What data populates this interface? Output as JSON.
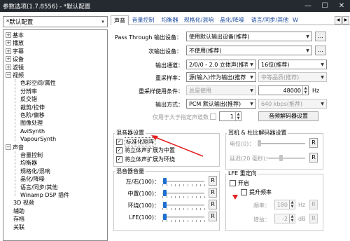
{
  "window": {
    "title": "参数选项(1.7.8556) - *默认配置",
    "minimize": "—",
    "maximize": "☐",
    "close": "✕"
  },
  "preset": {
    "value": "*默认配置",
    "arrow": "▾"
  },
  "tree": [
    {
      "label": "基本",
      "expander": "+"
    },
    {
      "label": "播放",
      "expander": "+"
    },
    {
      "label": "字幕",
      "expander": "+"
    },
    {
      "label": "设备",
      "expander": "+"
    },
    {
      "label": "滤镜",
      "expander": "+"
    },
    {
      "label": "视频",
      "expander": "−"
    },
    {
      "label": "色彩空间/属性"
    },
    {
      "label": "分辨率"
    },
    {
      "label": "反交错"
    },
    {
      "label": "裁剪/拉伸"
    },
    {
      "label": "色阶/偏移"
    },
    {
      "label": "图像处理"
    },
    {
      "label": "AviSynth"
    },
    {
      "label": "VapourSynth"
    },
    {
      "label": "声音",
      "expander": "−"
    },
    {
      "label": "音量控制"
    },
    {
      "label": "均衡器"
    },
    {
      "label": "规格化/混响"
    },
    {
      "label": "晶化/降噪"
    },
    {
      "label": "语言/同步/其他"
    },
    {
      "label": "Winamp DSP 插件"
    },
    {
      "label": "3D 视频"
    },
    {
      "label": "辅助"
    },
    {
      "label": "存档"
    },
    {
      "label": "关联"
    }
  ],
  "tabs": {
    "items": [
      "声音",
      "音量控制",
      "均衡器",
      "规格化/混响",
      "晶化/降噪",
      "语言/同步/其他",
      "W"
    ],
    "scroll_left": "◀",
    "scroll_right": "▶"
  },
  "output": {
    "passthrough_label": "Pass Through 输出设备：",
    "passthrough_value": "使用默认输出设备(推荐)",
    "secondary_label": "次输出设备：",
    "secondary_value": "不使用(推荐)",
    "more_button": "...",
    "channel_label": "输出通道：",
    "channel_value": "2/0/0 - 2.0 立体声(推荐",
    "bits_value": "16位(推荐)",
    "resample_label": "重采样率：",
    "resample_value": "源(输入)作为输出(推荐",
    "quality_value": "中等品质(推荐)",
    "condition_label": "重采样使用条件：",
    "condition_value": "总是使用",
    "rate_value": "48000",
    "rate_unit": "Hz",
    "method_label": "输出方式：",
    "method_value": "PCM 默认输出(推荐)",
    "bitrate_value": "640 kbps(推荐)",
    "channel_cond_label": "仅用于大于指定声道数",
    "channel_cond_value": "1",
    "decoder_button": "音频解码器设置"
  },
  "mixer": {
    "title": "混音器设置",
    "items": [
      {
        "label": "标准化矩阵",
        "checked": true
      },
      {
        "label": "将立体声扩展为中置",
        "checked": true
      },
      {
        "label": "将立体声扩展为环绕",
        "checked": true
      }
    ],
    "check_mark": "✓"
  },
  "mixer_volume": {
    "title": "混音器音量",
    "rows": [
      {
        "label": "左/右(100)：",
        "level": 0.05
      },
      {
        "label": "中置(100)：",
        "level": 0.05
      },
      {
        "label": "环绕(100)：",
        "level": 0.05
      },
      {
        "label": "LFE(100)：",
        "level": 0.05
      }
    ],
    "reset_label": "R"
  },
  "headphone": {
    "title": "耳机 & 杜比解码器设置",
    "level_label": "电位(0)：",
    "delay_label": "延迟(20 毫秒)：",
    "level_value": 0.0,
    "delay_value": 0.35,
    "reset_label": "R"
  },
  "lfe": {
    "title": "LFE 重定向",
    "enable_label": "开启",
    "boost_label": "提升频率",
    "freq_label": "频率：",
    "freq_value": "180",
    "freq_unit": "Hz",
    "gain_label": "增益：",
    "gain_value": "-2",
    "gain_unit": "dB",
    "reset_label": "R"
  },
  "colors": {
    "titlebar": "#252a30",
    "tab_text": "#1a4a9c",
    "slider_thumb": "#1e6fcf",
    "annotation": "#e02020"
  }
}
